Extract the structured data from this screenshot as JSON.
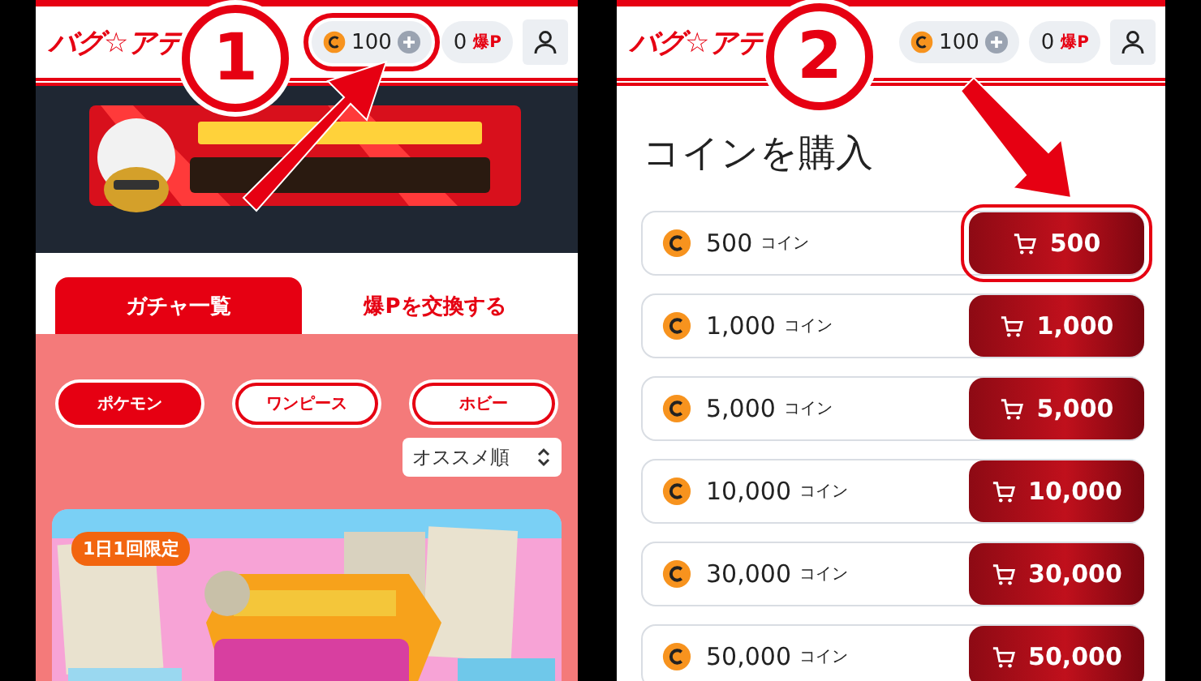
{
  "step_1": {
    "badge": "1",
    "header": {
      "logo": "バグ☆アテ",
      "coins": "100",
      "points": "0",
      "points_unit": "爆P",
      "coins_highlighted": true
    },
    "tabs": [
      {
        "label": "ガチャ一覧",
        "selected": true
      },
      {
        "label": "爆Pを交換する",
        "selected": false
      }
    ],
    "filters": [
      {
        "label": "ポケモン",
        "selected": true
      },
      {
        "label": "ワンピース",
        "selected": false
      },
      {
        "label": "ホビー",
        "selected": false
      }
    ],
    "sort": {
      "value": "オススメ順"
    },
    "promo": {
      "tag": "1日1回限定"
    }
  },
  "step_2": {
    "badge": "2",
    "header": {
      "logo": "バグ☆アテ",
      "coins": "100",
      "points": "0",
      "points_unit": "爆P",
      "coins_highlighted": false
    },
    "title": "コインを購入",
    "packages": [
      {
        "amount": "500",
        "unit": "コイン",
        "price": "500",
        "highlighted": true
      },
      {
        "amount": "1,000",
        "unit": "コイン",
        "price": "1,000",
        "highlighted": false
      },
      {
        "amount": "5,000",
        "unit": "コイン",
        "price": "5,000",
        "highlighted": false
      },
      {
        "amount": "10,000",
        "unit": "コイン",
        "price": "10,000",
        "highlighted": false
      },
      {
        "amount": "30,000",
        "unit": "コイン",
        "price": "30,000",
        "highlighted": false
      },
      {
        "amount": "50,000",
        "unit": "コイン",
        "price": "50,000",
        "highlighted": false
      }
    ]
  }
}
